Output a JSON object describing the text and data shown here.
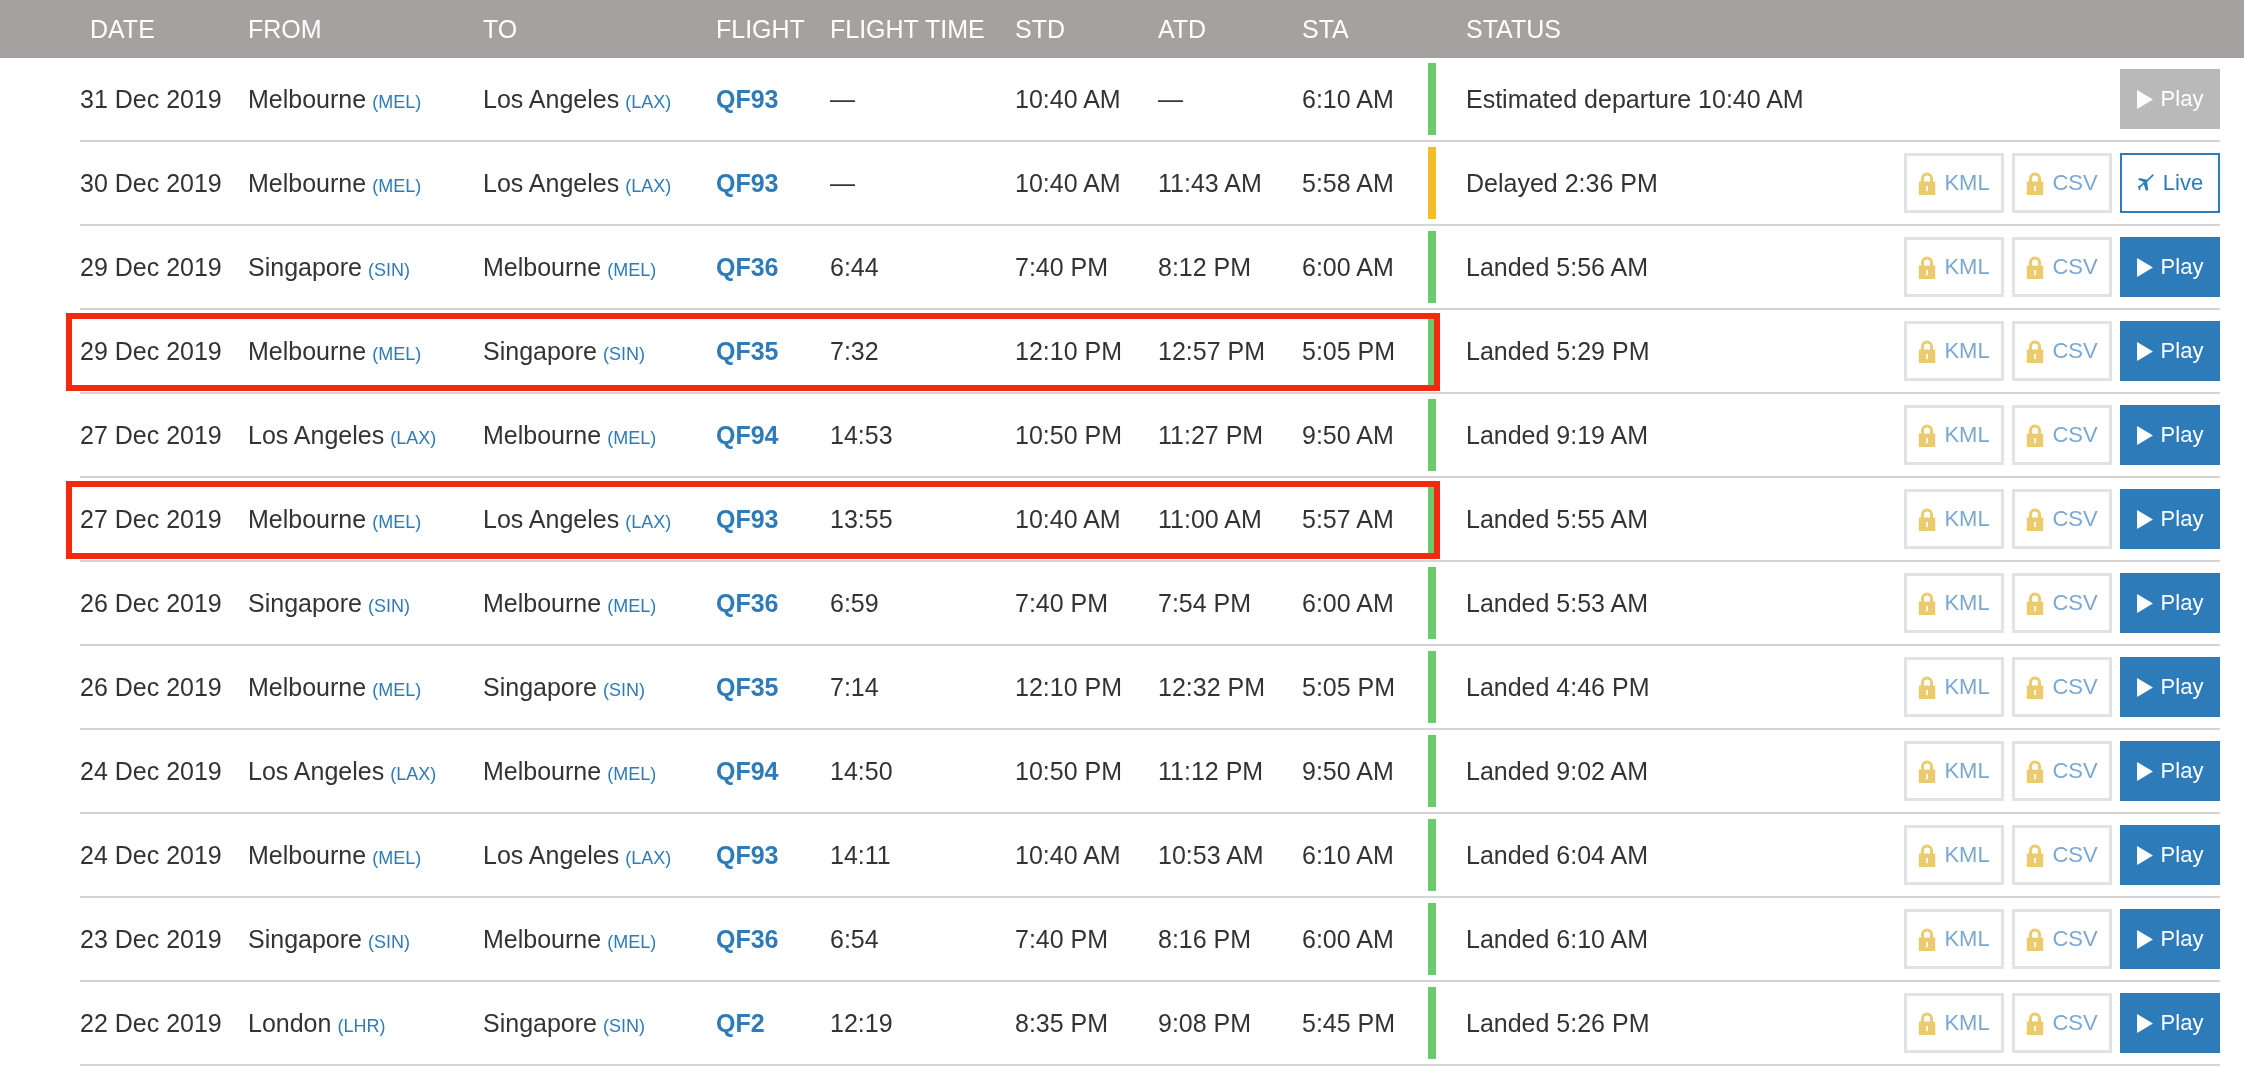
{
  "columns": [
    "DATE",
    "FROM",
    "TO",
    "FLIGHT",
    "FLIGHT TIME",
    "STD",
    "ATD",
    "STA",
    "STATUS"
  ],
  "rows": [
    {
      "date": "31 Dec 2019",
      "from": {
        "city": "Melbourne",
        "code": "(MEL)"
      },
      "to": {
        "city": "Los Angeles",
        "code": "(LAX)"
      },
      "flight": "QF93",
      "flight_time": "—",
      "std": "10:40 AM",
      "atd": "—",
      "sta": "6:10 AM",
      "status": "Estimated departure 10:40 AM",
      "color": "#6cc96e",
      "highlighted": false,
      "actions": [
        {
          "kind": "play",
          "label": "Play",
          "disabled": true
        }
      ]
    },
    {
      "date": "30 Dec 2019",
      "from": {
        "city": "Melbourne",
        "code": "(MEL)"
      },
      "to": {
        "city": "Los Angeles",
        "code": "(LAX)"
      },
      "flight": "QF93",
      "flight_time": "—",
      "std": "10:40 AM",
      "atd": "11:43 AM",
      "sta": "5:58 AM",
      "status": "Delayed 2:36 PM",
      "color": "#f5bd2a",
      "highlighted": false,
      "actions": [
        {
          "kind": "kml",
          "label": "KML",
          "disabled": false
        },
        {
          "kind": "csv",
          "label": "CSV",
          "disabled": false
        },
        {
          "kind": "live",
          "label": "Live",
          "disabled": false
        }
      ]
    },
    {
      "date": "29 Dec 2019",
      "from": {
        "city": "Singapore",
        "code": "(SIN)"
      },
      "to": {
        "city": "Melbourne",
        "code": "(MEL)"
      },
      "flight": "QF36",
      "flight_time": "6:44",
      "std": "7:40 PM",
      "atd": "8:12 PM",
      "sta": "6:00 AM",
      "status": "Landed 5:56 AM",
      "color": "#6cc96e",
      "highlighted": false,
      "actions": [
        {
          "kind": "kml",
          "label": "KML",
          "disabled": false
        },
        {
          "kind": "csv",
          "label": "CSV",
          "disabled": false
        },
        {
          "kind": "play",
          "label": "Play",
          "disabled": false
        }
      ]
    },
    {
      "date": "29 Dec 2019",
      "from": {
        "city": "Melbourne",
        "code": "(MEL)"
      },
      "to": {
        "city": "Singapore",
        "code": "(SIN)"
      },
      "flight": "QF35",
      "flight_time": "7:32",
      "std": "12:10 PM",
      "atd": "12:57 PM",
      "sta": "5:05 PM",
      "status": "Landed 5:29 PM",
      "color": "#6cc96e",
      "highlighted": true,
      "actions": [
        {
          "kind": "kml",
          "label": "KML",
          "disabled": false
        },
        {
          "kind": "csv",
          "label": "CSV",
          "disabled": false
        },
        {
          "kind": "play",
          "label": "Play",
          "disabled": false
        }
      ]
    },
    {
      "date": "27 Dec 2019",
      "from": {
        "city": "Los Angeles",
        "code": "(LAX)"
      },
      "to": {
        "city": "Melbourne",
        "code": "(MEL)"
      },
      "flight": "QF94",
      "flight_time": "14:53",
      "std": "10:50 PM",
      "atd": "11:27 PM",
      "sta": "9:50 AM",
      "status": "Landed 9:19 AM",
      "color": "#6cc96e",
      "highlighted": false,
      "actions": [
        {
          "kind": "kml",
          "label": "KML",
          "disabled": false
        },
        {
          "kind": "csv",
          "label": "CSV",
          "disabled": false
        },
        {
          "kind": "play",
          "label": "Play",
          "disabled": false
        }
      ]
    },
    {
      "date": "27 Dec 2019",
      "from": {
        "city": "Melbourne",
        "code": "(MEL)"
      },
      "to": {
        "city": "Los Angeles",
        "code": "(LAX)"
      },
      "flight": "QF93",
      "flight_time": "13:55",
      "std": "10:40 AM",
      "atd": "11:00 AM",
      "sta": "5:57 AM",
      "status": "Landed 5:55 AM",
      "color": "#6cc96e",
      "highlighted": true,
      "actions": [
        {
          "kind": "kml",
          "label": "KML",
          "disabled": false
        },
        {
          "kind": "csv",
          "label": "CSV",
          "disabled": false
        },
        {
          "kind": "play",
          "label": "Play",
          "disabled": false
        }
      ]
    },
    {
      "date": "26 Dec 2019",
      "from": {
        "city": "Singapore",
        "code": "(SIN)"
      },
      "to": {
        "city": "Melbourne",
        "code": "(MEL)"
      },
      "flight": "QF36",
      "flight_time": "6:59",
      "std": "7:40 PM",
      "atd": "7:54 PM",
      "sta": "6:00 AM",
      "status": "Landed 5:53 AM",
      "color": "#6cc96e",
      "highlighted": false,
      "actions": [
        {
          "kind": "kml",
          "label": "KML",
          "disabled": false
        },
        {
          "kind": "csv",
          "label": "CSV",
          "disabled": false
        },
        {
          "kind": "play",
          "label": "Play",
          "disabled": false
        }
      ]
    },
    {
      "date": "26 Dec 2019",
      "from": {
        "city": "Melbourne",
        "code": "(MEL)"
      },
      "to": {
        "city": "Singapore",
        "code": "(SIN)"
      },
      "flight": "QF35",
      "flight_time": "7:14",
      "std": "12:10 PM",
      "atd": "12:32 PM",
      "sta": "5:05 PM",
      "status": "Landed 4:46 PM",
      "color": "#6cc96e",
      "highlighted": false,
      "actions": [
        {
          "kind": "kml",
          "label": "KML",
          "disabled": false
        },
        {
          "kind": "csv",
          "label": "CSV",
          "disabled": false
        },
        {
          "kind": "play",
          "label": "Play",
          "disabled": false
        }
      ]
    },
    {
      "date": "24 Dec 2019",
      "from": {
        "city": "Los Angeles",
        "code": "(LAX)"
      },
      "to": {
        "city": "Melbourne",
        "code": "(MEL)"
      },
      "flight": "QF94",
      "flight_time": "14:50",
      "std": "10:50 PM",
      "atd": "11:12 PM",
      "sta": "9:50 AM",
      "status": "Landed 9:02 AM",
      "color": "#6cc96e",
      "highlighted": false,
      "actions": [
        {
          "kind": "kml",
          "label": "KML",
          "disabled": false
        },
        {
          "kind": "csv",
          "label": "CSV",
          "disabled": false
        },
        {
          "kind": "play",
          "label": "Play",
          "disabled": false
        }
      ]
    },
    {
      "date": "24 Dec 2019",
      "from": {
        "city": "Melbourne",
        "code": "(MEL)"
      },
      "to": {
        "city": "Los Angeles",
        "code": "(LAX)"
      },
      "flight": "QF93",
      "flight_time": "14:11",
      "std": "10:40 AM",
      "atd": "10:53 AM",
      "sta": "6:10 AM",
      "status": "Landed 6:04 AM",
      "color": "#6cc96e",
      "highlighted": false,
      "actions": [
        {
          "kind": "kml",
          "label": "KML",
          "disabled": false
        },
        {
          "kind": "csv",
          "label": "CSV",
          "disabled": false
        },
        {
          "kind": "play",
          "label": "Play",
          "disabled": false
        }
      ]
    },
    {
      "date": "23 Dec 2019",
      "from": {
        "city": "Singapore",
        "code": "(SIN)"
      },
      "to": {
        "city": "Melbourne",
        "code": "(MEL)"
      },
      "flight": "QF36",
      "flight_time": "6:54",
      "std": "7:40 PM",
      "atd": "8:16 PM",
      "sta": "6:00 AM",
      "status": "Landed 6:10 AM",
      "color": "#6cc96e",
      "highlighted": false,
      "actions": [
        {
          "kind": "kml",
          "label": "KML",
          "disabled": false
        },
        {
          "kind": "csv",
          "label": "CSV",
          "disabled": false
        },
        {
          "kind": "play",
          "label": "Play",
          "disabled": false
        }
      ]
    },
    {
      "date": "22 Dec 2019",
      "from": {
        "city": "London",
        "code": "(LHR)"
      },
      "to": {
        "city": "Singapore",
        "code": "(SIN)"
      },
      "flight": "QF2",
      "flight_time": "12:19",
      "std": "8:35 PM",
      "atd": "9:08 PM",
      "sta": "5:45 PM",
      "status": "Landed 5:26 PM",
      "color": "#6cc96e",
      "highlighted": false,
      "actions": [
        {
          "kind": "kml",
          "label": "KML",
          "disabled": false
        },
        {
          "kind": "csv",
          "label": "CSV",
          "disabled": false
        },
        {
          "kind": "play",
          "label": "Play",
          "disabled": false
        }
      ]
    }
  ]
}
